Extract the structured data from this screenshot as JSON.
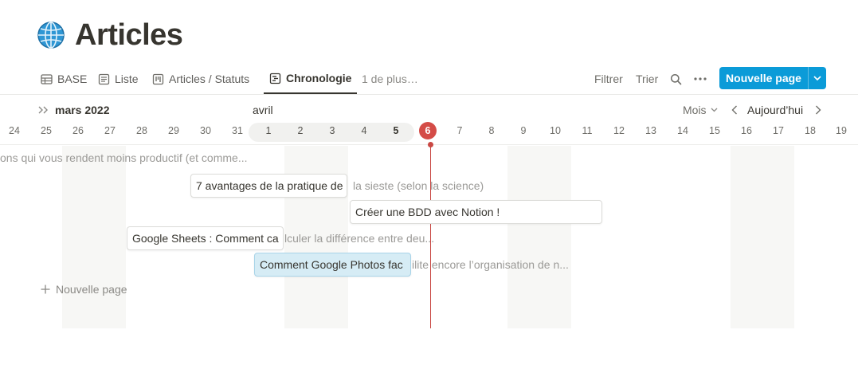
{
  "page": {
    "title": "Articles",
    "icon": "globe-icon"
  },
  "views": [
    {
      "label": "BASE",
      "icon": "table-icon"
    },
    {
      "label": "Liste",
      "icon": "list-icon"
    },
    {
      "label": "Articles / Statuts",
      "icon": "board-icon"
    },
    {
      "label": "Chronologie",
      "icon": "timeline-icon",
      "active": true
    },
    {
      "label": "1 de plus…"
    }
  ],
  "toolbar": {
    "filter": "Filtrer",
    "sort": "Trier",
    "new_page": "Nouvelle page"
  },
  "timeline": {
    "month_left": "mars 2022",
    "month_right": "avril",
    "zoom": "Mois",
    "today_label": "Aujourd’hui",
    "days": [
      "24",
      "25",
      "26",
      "27",
      "28",
      "29",
      "30",
      "31",
      "1",
      "2",
      "3",
      "4",
      "5",
      "6",
      "7",
      "8",
      "9",
      "10",
      "11",
      "12",
      "13",
      "14",
      "15",
      "16",
      "17",
      "18",
      "19"
    ],
    "today": "6"
  },
  "items": [
    {
      "visible": "",
      "overflow": "ons qui vous rendent moins productif (et comme..."
    },
    {
      "visible": "7 avantages de la pratique de",
      "overflow": "la sieste (selon la science)"
    },
    {
      "visible": "Créer une BDD avec Notion !",
      "overflow": ""
    },
    {
      "visible": "Google Sheets : Comment ca",
      "overflow": "lculer la différence entre deu..."
    },
    {
      "visible": "Comment Google Photos fac",
      "overflow": "ilite encore l’organisation de n..."
    }
  ],
  "add_row": "Nouvelle page",
  "colors": {
    "accent": "#0b9bd8",
    "today": "#d44c47"
  }
}
